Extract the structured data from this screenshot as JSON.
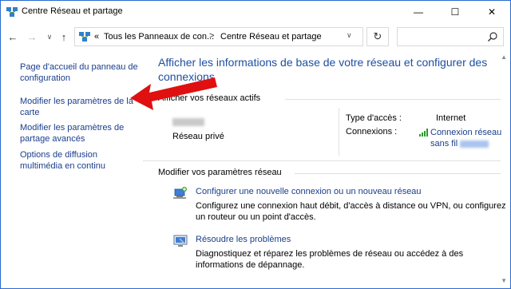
{
  "window": {
    "title": "Centre Réseau et partage",
    "controls": {
      "minimize": "—",
      "maximize": "☐",
      "close": "✕"
    }
  },
  "address_bar": {
    "breadcrumb_prefix": "«",
    "crumb1": "Tous les Panneaux de con...",
    "separator": ">",
    "crumb2": "Centre Réseau et partage",
    "search_placeholder": ""
  },
  "sidebar": {
    "items": [
      {
        "label": "Page d'accueil du panneau de configuration"
      },
      {
        "label": "Modifier les paramètres de la carte"
      },
      {
        "label": "Modifier les paramètres de partage avancés"
      },
      {
        "label": "Options de diffusion multimédia en continu"
      }
    ]
  },
  "main": {
    "heading": "Afficher les informations de base de votre réseau et configurer des connexions",
    "active_networks": {
      "title": "Afficher vos réseaux actifs",
      "network_type": "Réseau privé",
      "access_type_label": "Type d'accès :",
      "access_type_value": "Internet",
      "connections_label": "Connexions :",
      "connection_link_line1": "Connexion réseau",
      "connection_link_line2": "sans fil"
    },
    "change_settings": {
      "title": "Modifier vos paramètres réseau",
      "tasks": [
        {
          "link": "Configurer une nouvelle connexion ou un nouveau réseau",
          "description": "Configurez une connexion haut débit, d'accès à distance ou VPN, ou configurez un routeur ou un point d'accès.",
          "icon": "new-connection-icon"
        },
        {
          "link": "Résoudre les problèmes",
          "description": "Diagnostiquez et réparez les problèmes de réseau ou accédez à des informations de dépannage.",
          "icon": "troubleshoot-icon"
        }
      ]
    }
  },
  "colors": {
    "link": "#1a3e8c",
    "heading": "#1e4fa1",
    "annotation_arrow": "#e01010",
    "window_border": "#2b6bd1"
  }
}
